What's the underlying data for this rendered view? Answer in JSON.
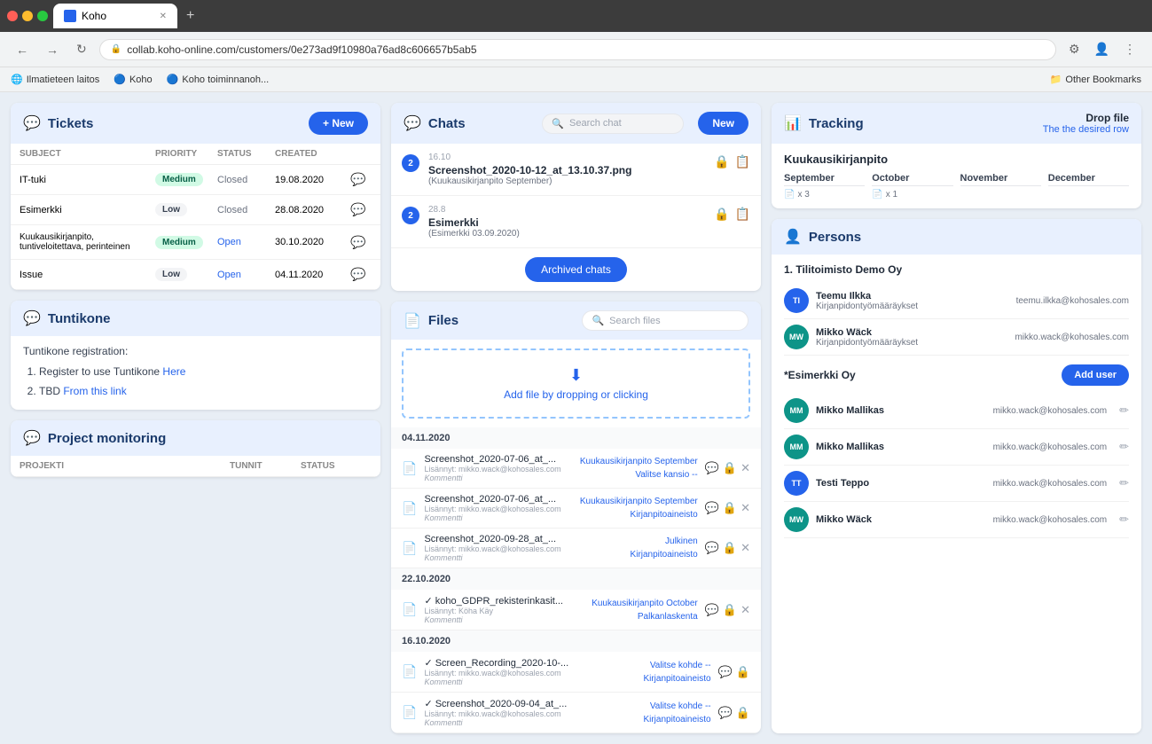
{
  "browser": {
    "tab_title": "Koho",
    "url": "collab.koho-online.com/customers/0e273ad9f10980a76ad8c606657b5ab5",
    "new_tab_label": "+",
    "back": "←",
    "forward": "→",
    "reload": "↻"
  },
  "bookmarks": [
    {
      "id": "bm1",
      "label": "Ilmatieteen laitos"
    },
    {
      "id": "bm2",
      "label": "Koho"
    },
    {
      "id": "bm3",
      "label": "Koho toiminnanoh..."
    },
    {
      "id": "bm4",
      "label": "Other Bookmarks"
    }
  ],
  "tickets": {
    "title": "Tickets",
    "new_label": "+ New",
    "columns": {
      "subject": "SUBJECT",
      "priority": "Priority",
      "status": "Status",
      "created": "CREATED"
    },
    "rows": [
      {
        "subject": "IT-tuki",
        "priority": "Medium",
        "priority_type": "medium",
        "status": "Closed",
        "status_type": "closed",
        "created": "19.08.2020"
      },
      {
        "subject": "Esimerkki",
        "priority": "Low",
        "priority_type": "low",
        "status": "Closed",
        "status_type": "closed",
        "created": "28.08.2020"
      },
      {
        "subject": "Kuukausikirjanpito, tuntiveloitettava, perinteinen",
        "priority": "Medium",
        "priority_type": "medium",
        "status": "Open",
        "status_type": "open",
        "created": "30.10.2020"
      },
      {
        "subject": "Issue",
        "priority": "Low",
        "priority_type": "low",
        "status": "Open",
        "status_type": "open",
        "created": "04.11.2020"
      }
    ]
  },
  "tuntikone": {
    "title": "Tuntikone",
    "registration_label": "Tuntikone registration:",
    "steps": [
      {
        "text": "Register to use Tuntikone ",
        "link_text": "Here",
        "link": "#"
      },
      {
        "text": "TBD ",
        "link_text": "From this link",
        "link": "#"
      }
    ]
  },
  "project_monitoring": {
    "title": "Project monitoring",
    "columns": {
      "project": "PROJEKTI",
      "hours": "TUNNIT",
      "status": "STATUS"
    }
  },
  "chats": {
    "title": "Chats",
    "search_placeholder": "Search chat",
    "new_label": "New",
    "items": [
      {
        "count": "2",
        "timestamp": "16.10",
        "name": "Screenshot_2020-10-12_at_13.10.37.png",
        "subtitle": "(Kuukausikirjanpito September)"
      },
      {
        "count": "2",
        "timestamp": "28.8",
        "name": "Esimerkki",
        "subtitle": "(Esimerkki 03.09.2020)"
      }
    ],
    "archived_label": "Archived chats"
  },
  "files": {
    "title": "Files",
    "search_placeholder": "Search files",
    "drop_label": "Add file by dropping or clicking",
    "dates": [
      {
        "date": "04.11.2020",
        "items": [
          {
            "name": "Screenshot_2020-07-06_at_...",
            "uploader": "Lisännyt: mikko.wack@kohosales.com",
            "comment": "Kommentti",
            "tags": "Kuukausikirjanpito September\nValitse kansio --"
          },
          {
            "name": "Screenshot_2020-07-06_at_...",
            "uploader": "Lisännyt: mikko.wack@kohosales.com",
            "comment": "Kommentti",
            "tags": "Kuukausikirjanpito September\nKirjanpitoaineisto"
          },
          {
            "name": "Screenshot_2020-09-28_at_...",
            "uploader": "Lisännyt: mikko.wack@kohosales.com",
            "comment": "Kommentti",
            "tags": "Julkinen\nKirjanpitoaineisto"
          }
        ]
      },
      {
        "date": "22.10.2020",
        "items": [
          {
            "name": "✓ koho_GDPR_rekisterinkasit...",
            "uploader": "Lisännyt: Köha Käy",
            "comment": "Kommentti",
            "tags": "Kuukausikirjanpito October\nPalkanlaskenta",
            "locked": true
          }
        ]
      },
      {
        "date": "16.10.2020",
        "items": [
          {
            "name": "✓ Screen_Recording_2020-10-...",
            "uploader": "Lisännyt: mikko.wack@kohosales.com",
            "comment": "Kommentti",
            "tags": "Valitse kohde --\nKirjanpitoaineisto"
          },
          {
            "name": "✓ Screenshot_2020-09-04_at_...",
            "uploader": "Lisännyt: mikko.wack@kohosales.com",
            "comment": "Kommentti",
            "tags": "Valitse kohde --\nKirjanpitoaineisto"
          }
        ]
      }
    ]
  },
  "tracking": {
    "title": "Tracking",
    "drop_title": "Drop file",
    "drop_subtitle": "The the desired row",
    "section_title": "Kuukausikirjanpito",
    "months": [
      {
        "name": "September",
        "items": [
          "x 3"
        ]
      },
      {
        "name": "October",
        "items": [
          "x 1"
        ]
      },
      {
        "name": "November",
        "items": []
      },
      {
        "name": "December",
        "items": []
      }
    ]
  },
  "persons": {
    "title": "Persons",
    "company1": {
      "name": "1. Tilitoimisto Demo Oy",
      "people": [
        {
          "initials": "TI",
          "name": "Teemu Ilkka",
          "role": "Kirjanpidontyömääräykset",
          "email": "teemu.ilkka@kohosales.com",
          "avatar_color": "blue"
        },
        {
          "initials": "MW",
          "name": "Mikko Wäck",
          "role": "Kirjanpidontyömääräykset",
          "email": "mikko.wack@kohosales.com",
          "avatar_color": "teal"
        }
      ]
    },
    "company2": {
      "name": "*Esimerkki Oy",
      "add_user_label": "Add user",
      "people": [
        {
          "initials": "MM",
          "name": "Mikko Mallikas",
          "role": "",
          "email": "mikko.wack@kohosales.com",
          "avatar_color": "teal"
        },
        {
          "initials": "MM",
          "name": "Mikko Mallikas",
          "role": "",
          "email": "mikko.wack@kohosales.com",
          "avatar_color": "teal"
        },
        {
          "initials": "TT",
          "name": "Testi Teppo",
          "role": "",
          "email": "mikko.wack@kohosales.com",
          "avatar_color": "blue"
        },
        {
          "initials": "MW",
          "name": "Mikko Wäck",
          "role": "",
          "email": "mikko.wack@kohosales.com",
          "avatar_color": "teal"
        }
      ]
    }
  }
}
